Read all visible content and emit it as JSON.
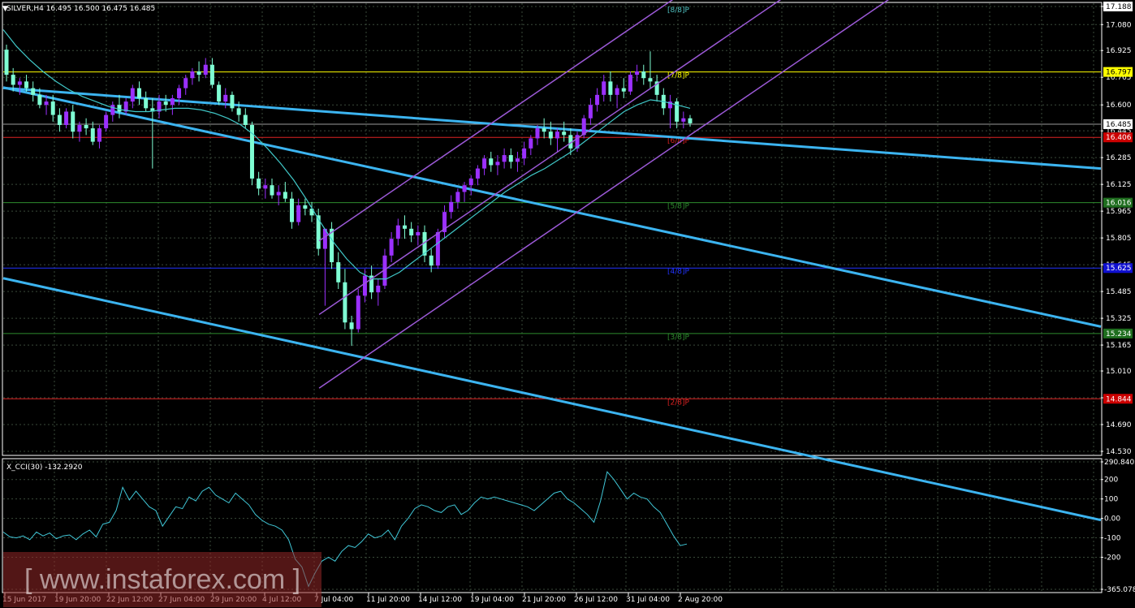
{
  "header": {
    "price_line": "SILVER,H4  16.495 16.500 16.475 16.485",
    "indicator_line": "X_CCI(30) -132.2920"
  },
  "watermark": "[ www.instaforex.com ]",
  "colors": {
    "background": "#000000",
    "grid": "#3a4a3a",
    "bull_candle": "#9b30ff",
    "bear_candle": "#7fffd4",
    "moving_average": "#40c8c8",
    "trend_channel": "#3cb4f0",
    "regression_channel": "#9b59d6",
    "cci_line": "#40c8d8"
  },
  "chart_data": [
    {
      "type": "candlestick",
      "symbol": "SILVER",
      "timeframe": "H4",
      "ylim": [
        14.53,
        17.188
      ],
      "y_ticks": [
        "17.188",
        "17.080",
        "16.925",
        "16.765",
        "16.600",
        "16.445",
        "16.285",
        "16.125",
        "15.965",
        "15.805",
        "15.645",
        "15.485",
        "15.325",
        "15.165",
        "15.010",
        "14.850",
        "14.690",
        "14.530"
      ],
      "x_ticks": [
        "15 Jun 2017",
        "19 Jun 20:00",
        "22 Jun 12:00",
        "27 Jun 04:00",
        "29 Jun 20:00",
        "4 Jul 12:00",
        "7 Jul 04:00",
        "11 Jul 20:00",
        "14 Jul 12:00",
        "19 Jul 04:00",
        "21 Jul 20:00",
        "26 Jul 12:00",
        "31 Jul 04:00",
        "2 Aug 20:00"
      ],
      "current_price": 16.485,
      "price_tags": [
        {
          "text": "17.188",
          "value": 17.188,
          "bg": "#ffffff",
          "fg": "#000000"
        },
        {
          "text": "16.797",
          "value": 16.797,
          "bg": "#ffff00",
          "fg": "#000000"
        },
        {
          "text": "16.485",
          "value": 16.485,
          "bg": "#ffffff",
          "fg": "#000000"
        },
        {
          "text": "16.406",
          "value": 16.406,
          "bg": "#cc0000",
          "fg": "#ffffff"
        },
        {
          "text": "16.016",
          "value": 16.016,
          "bg": "#1f6e1f",
          "fg": "#ffffff"
        },
        {
          "text": "15.625",
          "value": 15.625,
          "bg": "#1010d0",
          "fg": "#ffffff"
        },
        {
          "text": "15.234",
          "value": 15.234,
          "bg": "#1f6e1f",
          "fg": "#ffffff"
        },
        {
          "text": "14.844",
          "value": 14.844,
          "bg": "#cc0000",
          "fg": "#ffffff"
        }
      ],
      "murrey_levels": [
        {
          "label": "[8/8]P",
          "value": 17.188,
          "color": "#4fc3c3",
          "line": false
        },
        {
          "label": "[7/8]P",
          "value": 16.797,
          "color": "#ffff00",
          "line": true
        },
        {
          "label": "[6/8]P",
          "value": 16.406,
          "color": "#dd2222",
          "line": true
        },
        {
          "label": "[5/8]P",
          "value": 16.016,
          "color": "#2e8b2e",
          "line": true
        },
        {
          "label": "[4/8]P",
          "value": 15.625,
          "color": "#2233ff",
          "line": true
        },
        {
          "label": "[3/8]P",
          "value": 15.234,
          "color": "#2e8b2e",
          "line": true
        },
        {
          "label": "[2/8]P",
          "value": 14.844,
          "color": "#dd2222",
          "line": true
        }
      ],
      "bars": [
        [
          16.93,
          16.96,
          16.74,
          16.78
        ],
        [
          16.78,
          16.82,
          16.68,
          16.72
        ],
        [
          16.72,
          16.76,
          16.66,
          16.74
        ],
        [
          16.74,
          16.78,
          16.68,
          16.7
        ],
        [
          16.7,
          16.74,
          16.62,
          16.66
        ],
        [
          16.66,
          16.7,
          16.58,
          16.6
        ],
        [
          16.6,
          16.66,
          16.54,
          16.62
        ],
        [
          16.62,
          16.66,
          16.5,
          16.54
        ],
        [
          16.54,
          16.58,
          16.44,
          16.48
        ],
        [
          16.48,
          16.58,
          16.46,
          16.56
        ],
        [
          16.56,
          16.6,
          16.4,
          16.44
        ],
        [
          16.44,
          16.5,
          16.38,
          16.48
        ],
        [
          16.48,
          16.52,
          16.42,
          16.46
        ],
        [
          16.46,
          16.5,
          16.36,
          16.38
        ],
        [
          16.38,
          16.48,
          16.34,
          16.46
        ],
        [
          16.46,
          16.56,
          16.44,
          16.54
        ],
        [
          16.54,
          16.62,
          16.5,
          16.6
        ],
        [
          16.6,
          16.66,
          16.52,
          16.56
        ],
        [
          16.56,
          16.64,
          16.54,
          16.62
        ],
        [
          16.62,
          16.72,
          16.58,
          16.7
        ],
        [
          16.7,
          16.74,
          16.6,
          16.64
        ],
        [
          16.64,
          16.68,
          16.56,
          16.58
        ],
        [
          16.58,
          16.64,
          16.22,
          16.56
        ],
        [
          16.56,
          16.66,
          16.52,
          16.62
        ],
        [
          16.62,
          16.66,
          16.56,
          16.6
        ],
        [
          16.6,
          16.66,
          16.54,
          16.64
        ],
        [
          16.64,
          16.72,
          16.6,
          16.7
        ],
        [
          16.7,
          16.78,
          16.66,
          16.76
        ],
        [
          16.76,
          16.82,
          16.72,
          16.8
        ],
        [
          16.8,
          16.86,
          16.74,
          16.78
        ],
        [
          16.78,
          16.88,
          16.76,
          16.84
        ],
        [
          16.84,
          16.88,
          16.7,
          16.72
        ],
        [
          16.72,
          16.74,
          16.6,
          16.62
        ],
        [
          16.62,
          16.7,
          16.58,
          16.66
        ],
        [
          16.66,
          16.68,
          16.56,
          16.58
        ],
        [
          16.58,
          16.62,
          16.5,
          16.54
        ],
        [
          16.54,
          16.58,
          16.46,
          16.48
        ],
        [
          16.48,
          16.5,
          16.12,
          16.16
        ],
        [
          16.16,
          16.2,
          16.06,
          16.1
        ],
        [
          16.1,
          16.16,
          16.04,
          16.12
        ],
        [
          16.12,
          16.16,
          16.04,
          16.06
        ],
        [
          16.06,
          16.12,
          16.0,
          16.08
        ],
        [
          16.08,
          16.14,
          16.02,
          16.04
        ],
        [
          16.04,
          16.08,
          15.86,
          15.9
        ],
        [
          15.9,
          16.04,
          15.88,
          16.0
        ],
        [
          16.0,
          16.04,
          15.94,
          15.98
        ],
        [
          15.98,
          16.02,
          15.9,
          15.94
        ],
        [
          15.94,
          15.98,
          15.7,
          15.74
        ],
        [
          15.74,
          15.8,
          15.4,
          15.86
        ],
        [
          15.86,
          15.9,
          15.62,
          15.66
        ],
        [
          15.66,
          15.72,
          15.5,
          15.54
        ],
        [
          15.54,
          15.62,
          15.26,
          15.3
        ],
        [
          15.3,
          15.34,
          15.16,
          15.26
        ],
        [
          15.26,
          15.5,
          15.24,
          15.46
        ],
        [
          15.46,
          15.62,
          15.42,
          15.58
        ],
        [
          15.58,
          15.64,
          15.44,
          15.48
        ],
        [
          15.48,
          15.56,
          15.4,
          15.52
        ],
        [
          15.52,
          15.74,
          15.5,
          15.7
        ],
        [
          15.7,
          15.84,
          15.66,
          15.8
        ],
        [
          15.8,
          15.92,
          15.76,
          15.88
        ],
        [
          15.88,
          15.94,
          15.8,
          15.86
        ],
        [
          15.86,
          15.9,
          15.78,
          15.82
        ],
        [
          15.82,
          15.88,
          15.76,
          15.84
        ],
        [
          15.84,
          15.88,
          15.66,
          15.7
        ],
        [
          15.7,
          15.74,
          15.6,
          15.64
        ],
        [
          15.64,
          15.86,
          15.62,
          15.84
        ],
        [
          15.84,
          16.0,
          15.8,
          15.96
        ],
        [
          15.96,
          16.06,
          15.92,
          16.02
        ],
        [
          16.02,
          16.1,
          15.98,
          16.08
        ],
        [
          16.08,
          16.14,
          16.02,
          16.12
        ],
        [
          16.12,
          16.18,
          16.06,
          16.16
        ],
        [
          16.16,
          16.24,
          16.12,
          16.22
        ],
        [
          16.22,
          16.3,
          16.18,
          16.28
        ],
        [
          16.28,
          16.32,
          16.2,
          16.24
        ],
        [
          16.24,
          16.3,
          16.18,
          16.26
        ],
        [
          16.26,
          16.34,
          16.22,
          16.3
        ],
        [
          16.3,
          16.34,
          16.22,
          16.26
        ],
        [
          16.26,
          16.32,
          16.2,
          16.28
        ],
        [
          16.28,
          16.38,
          16.24,
          16.34
        ],
        [
          16.34,
          16.42,
          16.3,
          16.4
        ],
        [
          16.4,
          16.48,
          16.36,
          16.46
        ],
        [
          16.46,
          16.52,
          16.4,
          16.44
        ],
        [
          16.44,
          16.5,
          16.36,
          16.4
        ],
        [
          16.4,
          16.46,
          16.32,
          16.44
        ],
        [
          16.44,
          16.5,
          16.38,
          16.42
        ],
        [
          16.42,
          16.46,
          16.3,
          16.34
        ],
        [
          16.34,
          16.44,
          16.32,
          16.42
        ],
        [
          16.42,
          16.54,
          16.4,
          16.52
        ],
        [
          16.52,
          16.64,
          16.48,
          16.6
        ],
        [
          16.6,
          16.7,
          16.56,
          16.66
        ],
        [
          16.66,
          16.78,
          16.62,
          16.74
        ],
        [
          16.74,
          16.8,
          16.62,
          16.66
        ],
        [
          16.66,
          16.72,
          16.58,
          16.7
        ],
        [
          16.7,
          16.76,
          16.64,
          16.68
        ],
        [
          16.68,
          16.8,
          16.66,
          16.78
        ],
        [
          16.78,
          16.84,
          16.74,
          16.8
        ],
        [
          16.8,
          16.84,
          16.72,
          16.76
        ],
        [
          16.76,
          16.92,
          16.7,
          16.74
        ],
        [
          16.74,
          16.78,
          16.62,
          16.66
        ],
        [
          16.66,
          16.7,
          16.54,
          16.58
        ],
        [
          16.58,
          16.66,
          16.46,
          16.62
        ],
        [
          16.62,
          16.64,
          16.46,
          16.5
        ],
        [
          16.5,
          16.56,
          16.46,
          16.52
        ],
        [
          16.52,
          16.54,
          16.47,
          16.49
        ]
      ],
      "moving_average": [
        17.05,
        16.95,
        16.87,
        16.8,
        16.74,
        16.69,
        16.65,
        16.62,
        16.59,
        16.57,
        16.56,
        16.56,
        16.57,
        16.58,
        16.58,
        16.57,
        16.55,
        16.52,
        16.48,
        16.42,
        16.34,
        16.25,
        16.15,
        16.03,
        15.9,
        15.78,
        15.68,
        15.6,
        15.56,
        15.56,
        15.6,
        15.66,
        15.72,
        15.78,
        15.84,
        15.9,
        15.96,
        16.02,
        16.08,
        16.13,
        16.18,
        16.22,
        16.27,
        16.32,
        16.38,
        16.44,
        16.5,
        16.56,
        16.6,
        16.63,
        16.62,
        16.6,
        16.58
      ],
      "trend_lines": [
        {
          "x": [
            0,
            103
          ],
          "y": [
            16.7,
            16.4
          ],
          "role": "upper-descending"
        },
        {
          "x": [
            0,
            103
          ],
          "y": [
            16.7,
            15.81
          ],
          "role": "mid-descending"
        },
        {
          "x": [
            0,
            103
          ],
          "y": [
            15.56,
            14.66
          ],
          "role": "lower-descending"
        }
      ],
      "regression_channel": [
        {
          "x": [
            52,
            103
          ],
          "y": [
            15.92,
            17.3
          ],
          "role": "upper"
        },
        {
          "x": [
            52,
            103
          ],
          "y": [
            15.48,
            16.86
          ],
          "role": "middle"
        },
        {
          "x": [
            52,
            103
          ],
          "y": [
            15.04,
            16.42
          ],
          "role": "lower"
        }
      ]
    },
    {
      "type": "line",
      "name": "X_CCI(30)",
      "ylim": [
        -365.078,
        290.8402
      ],
      "y_ticks": [
        "290.8402",
        "200",
        "100",
        "0.00",
        "-100",
        "-200",
        "-365.078"
      ],
      "current_value": -132.292,
      "values": [
        -70,
        -95,
        -100,
        -90,
        -110,
        -70,
        -90,
        -75,
        -105,
        -90,
        -85,
        -110,
        -80,
        -60,
        -95,
        -30,
        -20,
        40,
        160,
        95,
        140,
        100,
        60,
        40,
        -40,
        10,
        60,
        50,
        110,
        90,
        140,
        160,
        120,
        100,
        80,
        130,
        100,
        70,
        20,
        -10,
        -30,
        -40,
        -60,
        -110,
        -210,
        -250,
        -350,
        -280,
        -220,
        -200,
        -220,
        -170,
        -140,
        -150,
        -120,
        -80,
        -100,
        -90,
        -60,
        -110,
        -40,
        0,
        50,
        70,
        60,
        40,
        30,
        60,
        70,
        20,
        40,
        80,
        110,
        100,
        110,
        100,
        90,
        80,
        70,
        60,
        40,
        70,
        100,
        130,
        140,
        100,
        80,
        50,
        20,
        -20,
        90,
        240,
        200,
        150,
        100,
        130,
        110,
        100,
        60,
        30,
        -30,
        -90,
        -140,
        -132
      ]
    }
  ]
}
